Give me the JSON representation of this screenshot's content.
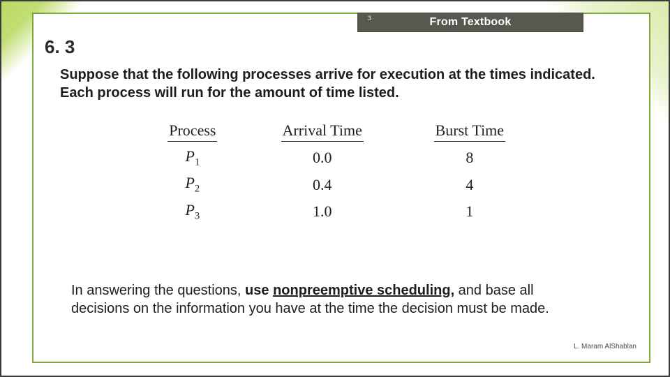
{
  "tag": {
    "page_number": "3",
    "label": "From Textbook"
  },
  "section_number": "6. 3",
  "intro_text": "Suppose that the following processes arrive for execution at the times indicated. Each process will run for the amount of time listed.",
  "chart_data": {
    "type": "table",
    "title": "",
    "columns": [
      "Process",
      "Arrival Time",
      "Burst Time"
    ],
    "rows": [
      {
        "process": "P1",
        "arrival": "0.0",
        "burst": "8"
      },
      {
        "process": "P2",
        "arrival": "0.4",
        "burst": "4"
      },
      {
        "process": "P3",
        "arrival": "1.0",
        "burst": "1"
      }
    ]
  },
  "instruction": {
    "lead": "In answering the questions, ",
    "bold_pre": "use ",
    "underline": "nonpreemptive scheduling",
    "after_underline": ",",
    "tail": " and base all decisions on the information you have at the time the decision must be made."
  },
  "author": "L. Maram AlShablan"
}
